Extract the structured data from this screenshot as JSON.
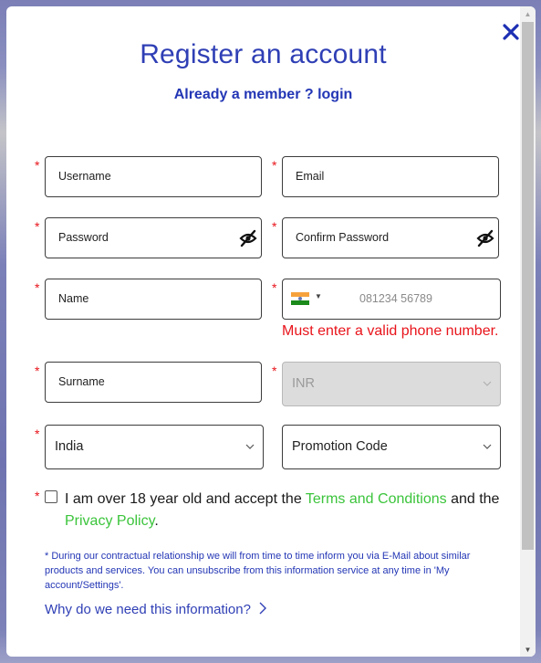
{
  "modal": {
    "title": "Register an account",
    "login_link": "Already a member ? login",
    "close_icon": "close-icon"
  },
  "form": {
    "required_mark": "*",
    "username": {
      "placeholder": "Username"
    },
    "email": {
      "placeholder": "Email"
    },
    "password": {
      "placeholder": "Password",
      "icon": "eye-slash-icon"
    },
    "confirm_password": {
      "placeholder": "Confirm Password",
      "icon": "eye-slash-icon"
    },
    "name": {
      "placeholder": "Name"
    },
    "phone": {
      "country_flag": "India",
      "placeholder": "081234 56789",
      "error": "Must enter a valid phone number."
    },
    "surname": {
      "placeholder": "Surname"
    },
    "currency": {
      "value": "INR",
      "disabled": true
    },
    "country": {
      "value": "India"
    },
    "promotion": {
      "value": "Promotion Code"
    },
    "consent": {
      "text_before": "I am over 18 year old and accept the ",
      "terms_link": "Terms and Conditions",
      "text_middle": " and the ",
      "privacy_link": "Privacy Policy",
      "text_after": ".",
      "checked": false
    },
    "note": "* During our contractual relationship we will from time to time inform you via E-Mail about similar products and services. You can unsubscribe from this information service at any time in 'My account/Settings'.",
    "why_link": "Why do we need this information?",
    "why_icon": "›"
  },
  "colors": {
    "primary": "#2f3fb5",
    "error": "#e8141b",
    "link_green": "#3bc43b"
  },
  "scrollbar": {
    "up": "▲",
    "down": "▼"
  }
}
